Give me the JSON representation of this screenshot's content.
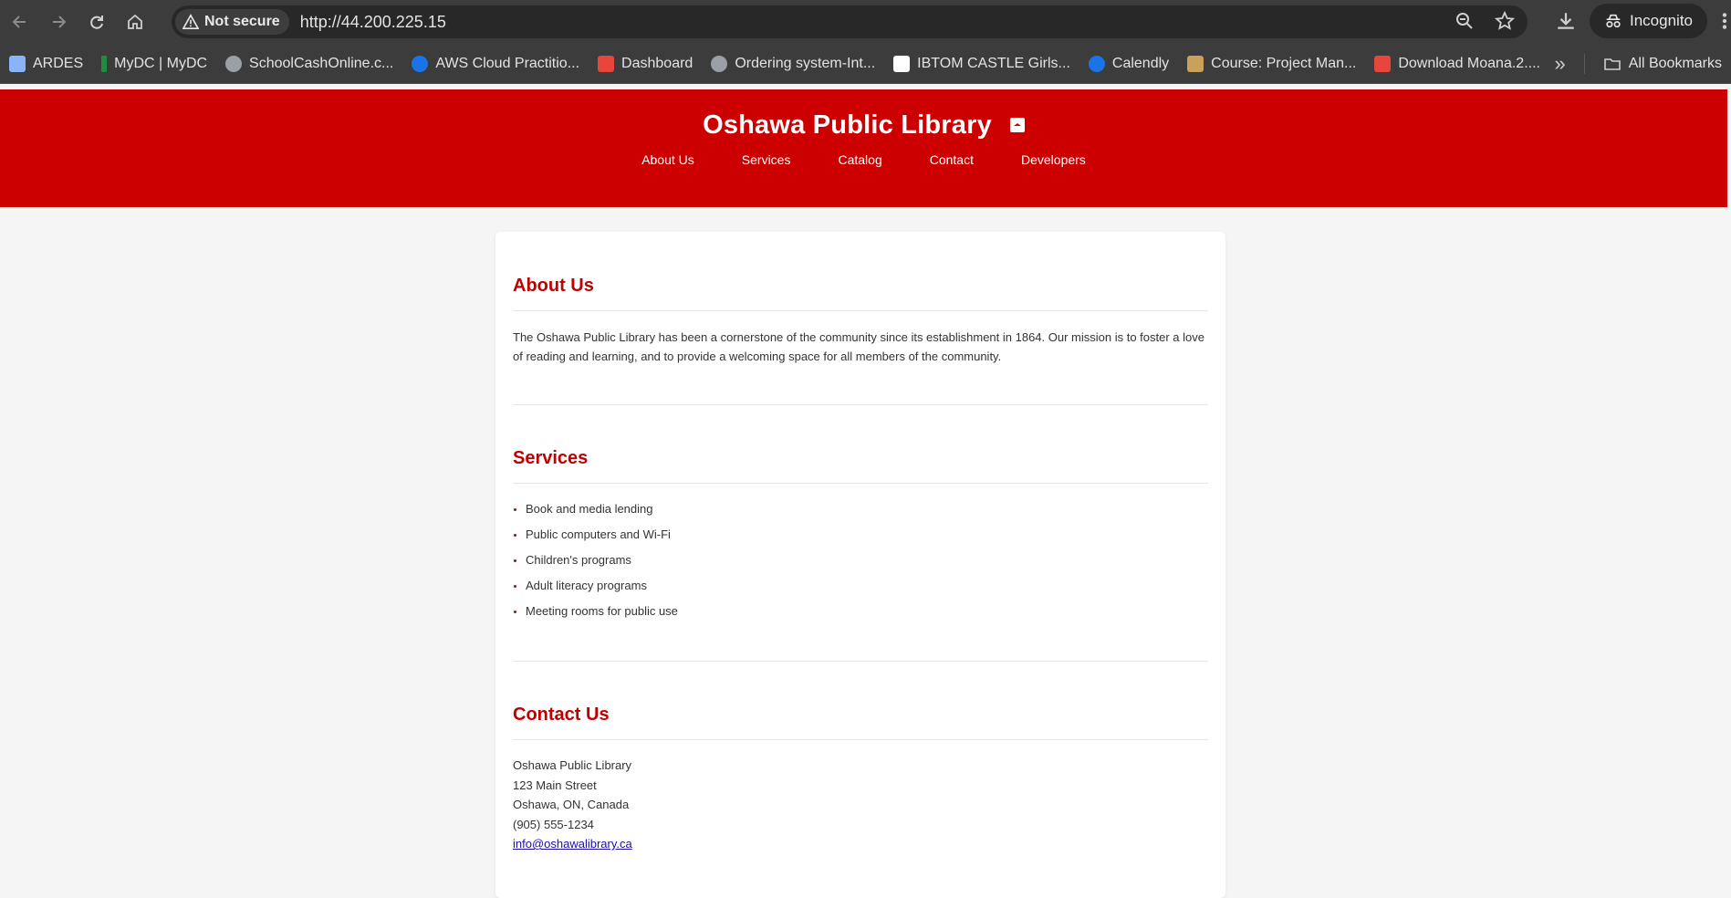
{
  "browser": {
    "security_label": "Not secure",
    "url": "http://44.200.225.15",
    "profile_label": "Incognito",
    "bookmarks": [
      {
        "label": "ARDES",
        "color": "#8ab4f8"
      },
      {
        "label": "MyDC | MyDC",
        "color": "#1e8e3e"
      },
      {
        "label": "SchoolCashOnline.c...",
        "color": "#9aa0a6"
      },
      {
        "label": "AWS Cloud Practitio...",
        "color": "#1a73e8"
      },
      {
        "label": "Dashboard",
        "color": "#e8453c"
      },
      {
        "label": "Ordering system-Int...",
        "color": "#9aa0a6"
      },
      {
        "label": "IBTOM CASTLE Girls...",
        "color": "#ffffff"
      },
      {
        "label": "Calendly",
        "color": "#1a73e8"
      },
      {
        "label": "Course: Project Man...",
        "color": "#c9a15a"
      },
      {
        "label": "Download Moana.2....",
        "color": "#e8453c"
      }
    ],
    "all_bookmarks_label": "All Bookmarks"
  },
  "site": {
    "title": "Oshawa Public Library",
    "nav": [
      "About Us",
      "Services",
      "Catalog",
      "Contact",
      "Developers"
    ],
    "accent_color": "#cc0000"
  },
  "about": {
    "heading": "About Us",
    "text": "The Oshawa Public Library has been a cornerstone of the community since its establishment in 1864. Our mission is to foster a love of reading and learning, and to provide a welcoming space for all members of the community."
  },
  "services": {
    "heading": "Services",
    "items": [
      "Book and media lending",
      "Public computers and Wi-Fi",
      "Children's programs",
      "Adult literacy programs",
      "Meeting rooms for public use"
    ]
  },
  "contact": {
    "heading": "Contact Us",
    "name": "Oshawa Public Library",
    "street": "123 Main Street",
    "city": "Oshawa, ON, Canada",
    "phone": "(905) 555-1234",
    "email": "info@oshawalibrary.ca"
  }
}
